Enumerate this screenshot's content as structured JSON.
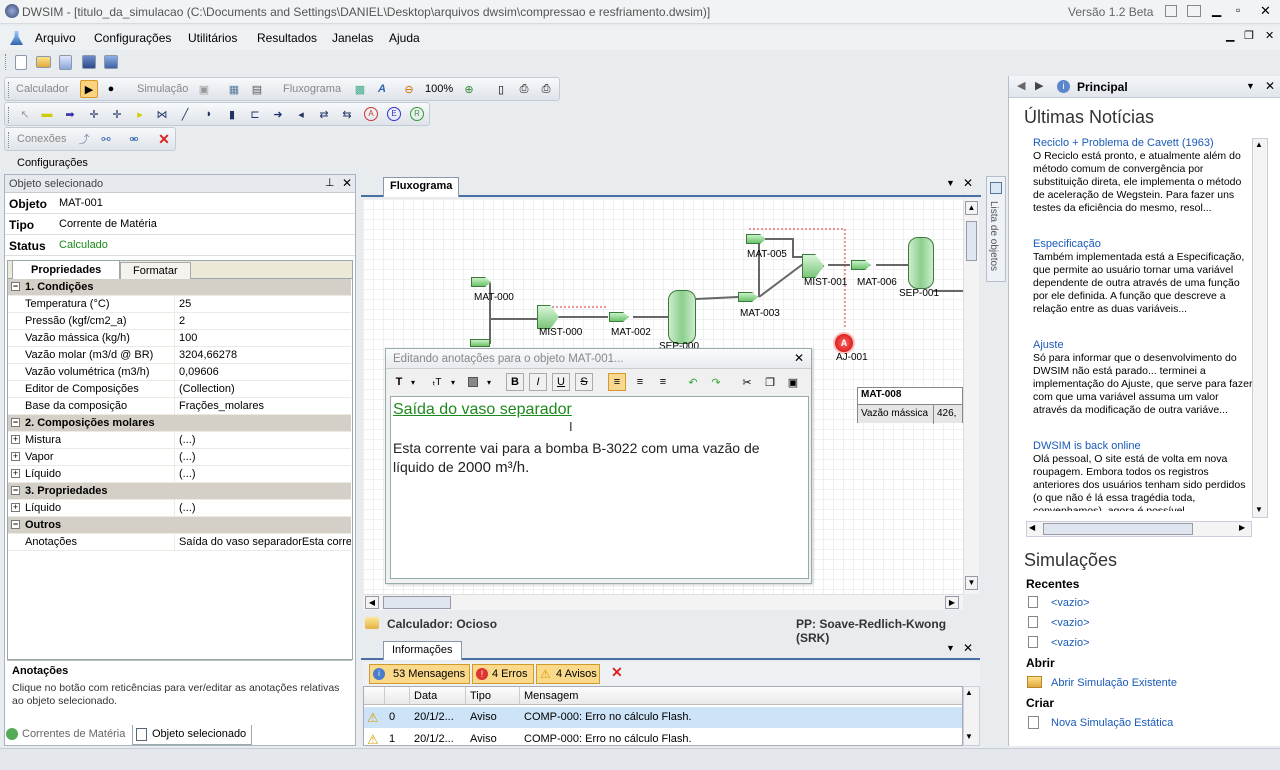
{
  "window": {
    "title": "DWSIM - [titulo_da_simulacao (C:\\Documents and Settings\\DANIEL\\Desktop\\arquivos dwsim\\compressao e resfriamento.dwsim)]",
    "version": "Versão 1.2 Beta"
  },
  "menu": [
    "Arquivo",
    "Configurações",
    "Utilitários",
    "Resultados",
    "Janelas",
    "Ajuda"
  ],
  "toolbar": {
    "calculador": "Calculador",
    "simulacao": "Simulação",
    "fluxograma": "Fluxograma",
    "zoom": "100%",
    "conexoes": "Conexões",
    "configuracoes": "Configurações"
  },
  "left_panel": {
    "header": "Objeto selecionado",
    "objeto_label": "Objeto",
    "objeto_value": "MAT-001",
    "tipo_label": "Tipo",
    "tipo_value": "Corrente de Matéria",
    "status_label": "Status",
    "status_value": "Calculado",
    "tabs": [
      "Propriedades",
      "Formatar"
    ],
    "categories": {
      "c1": "1. Condições",
      "c2": "2. Composições molares",
      "c3": "3. Propriedades",
      "c4": "Outros"
    },
    "props": [
      {
        "k": "Temperatura (°C)",
        "v": "25"
      },
      {
        "k": "Pressão (kgf/cm2_a)",
        "v": "2"
      },
      {
        "k": "Vazão mássica (kg/h)",
        "v": "100"
      },
      {
        "k": "Vazão molar (m3/d @ BR)",
        "v": "3204,66278"
      },
      {
        "k": "Vazão volumétrica (m3/h)",
        "v": "0,09606"
      },
      {
        "k": "Editor de Composições",
        "v": "(Collection)"
      },
      {
        "k": "Base da composição",
        "v": "Frações_molares"
      }
    ],
    "comp": [
      {
        "k": "Mistura",
        "v": "(...)"
      },
      {
        "k": "Vapor",
        "v": "(...)"
      },
      {
        "k": "Líquido",
        "v": "(...)"
      }
    ],
    "props3": [
      {
        "k": "Líquido",
        "v": "(...)"
      }
    ],
    "outros": [
      {
        "k": "Anotações",
        "v": "Saída do vaso separadorEsta corren"
      }
    ],
    "help_title": "Anotações",
    "help_text": "Clique no botão com reticências para ver/editar as anotações relativas ao objeto selecionado.",
    "bottom_tabs": [
      "Correntes de Matéria",
      "Objeto selecionado"
    ]
  },
  "flowsheet": {
    "tab": "Fluxograma",
    "side_label": "Lista de objetos",
    "streams": [
      "MAT-000",
      "MIST-000",
      "MAT-002",
      "SEP-000",
      "MAT-003",
      "MAT-005",
      "MIST-001",
      "MAT-006",
      "SEP-001",
      "AJ-001"
    ],
    "table_title": "MAT-008",
    "table_label": "Vazão mássica",
    "table_value": "426,"
  },
  "annotation_editor": {
    "title": "Editando anotações para o objeto MAT-001...",
    "heading": "Saída do vaso separador",
    "body_prefix": "Esta corrente vai para a bomba B-3022 com uma vazão de líquido de ",
    "body_value": "2000 m³/h."
  },
  "status": {
    "calculador": "Calculador: Ocioso",
    "pp": "PP: Soave-Redlich-Kwong (SRK)"
  },
  "info": {
    "tab": "Informações",
    "mensagens": "53 Mensagens",
    "erros": "4 Erros",
    "avisos": "4 Avisos",
    "columns": [
      "Data",
      "Tipo",
      "Mensagem"
    ],
    "rows": [
      {
        "n": "0",
        "data": "20/1/2...",
        "tipo": "Aviso",
        "msg": "COMP-000: Erro no cálculo Flash."
      },
      {
        "n": "1",
        "data": "20/1/2...",
        "tipo": "Aviso",
        "msg": "COMP-000: Erro no cálculo Flash."
      }
    ]
  },
  "right_panel": {
    "header": "Principal",
    "news_heading": "Últimas Notícias",
    "news": [
      {
        "title": "Reciclo + Problema de Cavett (1963)",
        "body": "O Reciclo está pronto, e atualmente além do método comum de convergência por substituição direta, ele implementa o método de aceleração de Wegstein. Para fazer uns testes da eficiência do mesmo, resol..."
      },
      {
        "title": "Especificação",
        "body": "Também implementada está a Especificação, que permite ao usuário tornar uma variável dependente de outra através de uma função por ele definida. A função que descreve a relação entre as duas variáveis..."
      },
      {
        "title": "Ajuste",
        "body": "Só para informar que o desenvolvimento do DWSIM não está parado... terminei a implementação do Ajuste, que serve para fazer com que uma variável assuma um valor através da modificação de outra variáve..."
      },
      {
        "title": "DWSIM is back online",
        "body": "Olá pessoal, O site está de volta em nova roupagem. Embora todos os registros anteriores dos usuários tenham sido perdidos (o que não é lá essa tragédia toda, convenhamos), agora é possível"
      }
    ],
    "sim_heading": "Simulações",
    "recentes": "Recentes",
    "recent_items": [
      "<vazio>",
      "<vazio>",
      "<vazio>"
    ],
    "abrir": "Abrir",
    "abrir_link": "Abrir Simulação Existente",
    "criar": "Criar",
    "criar_link": "Nova Simulação Estática"
  }
}
